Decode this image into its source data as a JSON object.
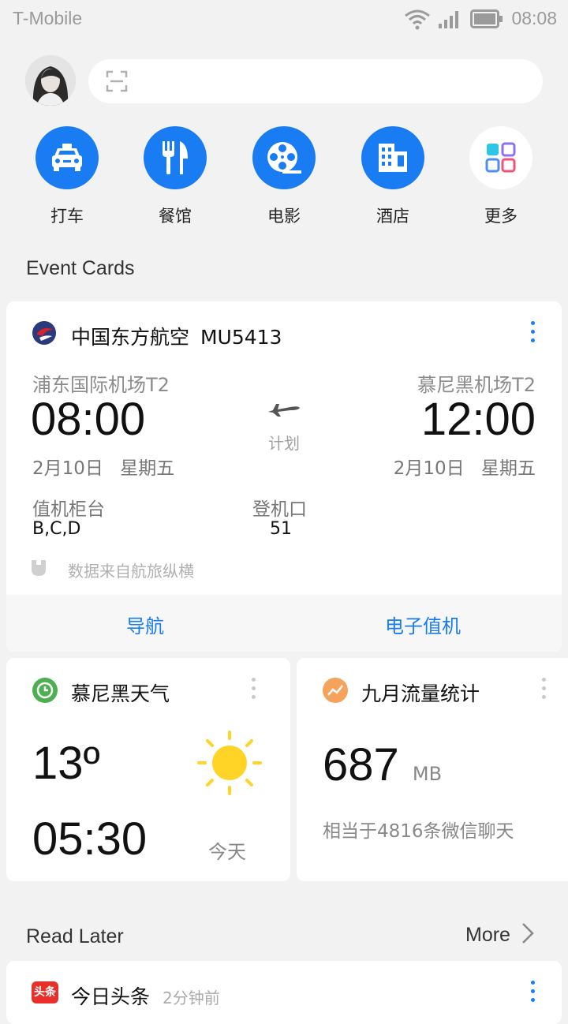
{
  "status_bar": {
    "carrier": "T-Mobile",
    "time": "08:08"
  },
  "search": {
    "placeholder": ""
  },
  "quick_apps": [
    {
      "label": "打车",
      "icon": "taxi-icon"
    },
    {
      "label": "餐馆",
      "icon": "restaurant-icon"
    },
    {
      "label": "电影",
      "icon": "film-reel-icon"
    },
    {
      "label": "酒店",
      "icon": "hotel-icon"
    },
    {
      "label": "更多",
      "icon": "more-grid-icon"
    }
  ],
  "event_cards_title": "Event Cards",
  "flight": {
    "airline": "中国东方航空",
    "flight_no": "MU5413",
    "depart_airport": "浦东国际机场T2",
    "arrive_airport": "慕尼黑机场T2",
    "depart_time": "08:00",
    "arrive_time": "12:00",
    "status": "计划",
    "depart_date": "2月10日",
    "depart_weekday": "星期五",
    "arrive_date": "2月10日",
    "arrive_weekday": "星期五",
    "counter_label": "值机柜台",
    "counter_value": "B,C,D",
    "gate_label": "登机口",
    "gate_value": "51",
    "source": "数据来自航旅纵横",
    "action_navigate": "导航",
    "action_checkin": "电子值机"
  },
  "weather": {
    "title": "慕尼黑天气",
    "temperature": "13º",
    "time": "05:30",
    "day": "今天"
  },
  "traffic": {
    "title": "九月流量统计",
    "value": "687",
    "unit": "MB",
    "note": "相当于4816条微信聊天"
  },
  "read_later": {
    "title": "Read Later",
    "more": "More",
    "item_source": "今日头条",
    "item_time": "2分钟前",
    "item_logo": "头条"
  },
  "colors": {
    "accent": "#1a7cf2",
    "weather_icon": "#4caf50",
    "traffic_icon": "#f5a25d",
    "sun": "#ffd426"
  }
}
